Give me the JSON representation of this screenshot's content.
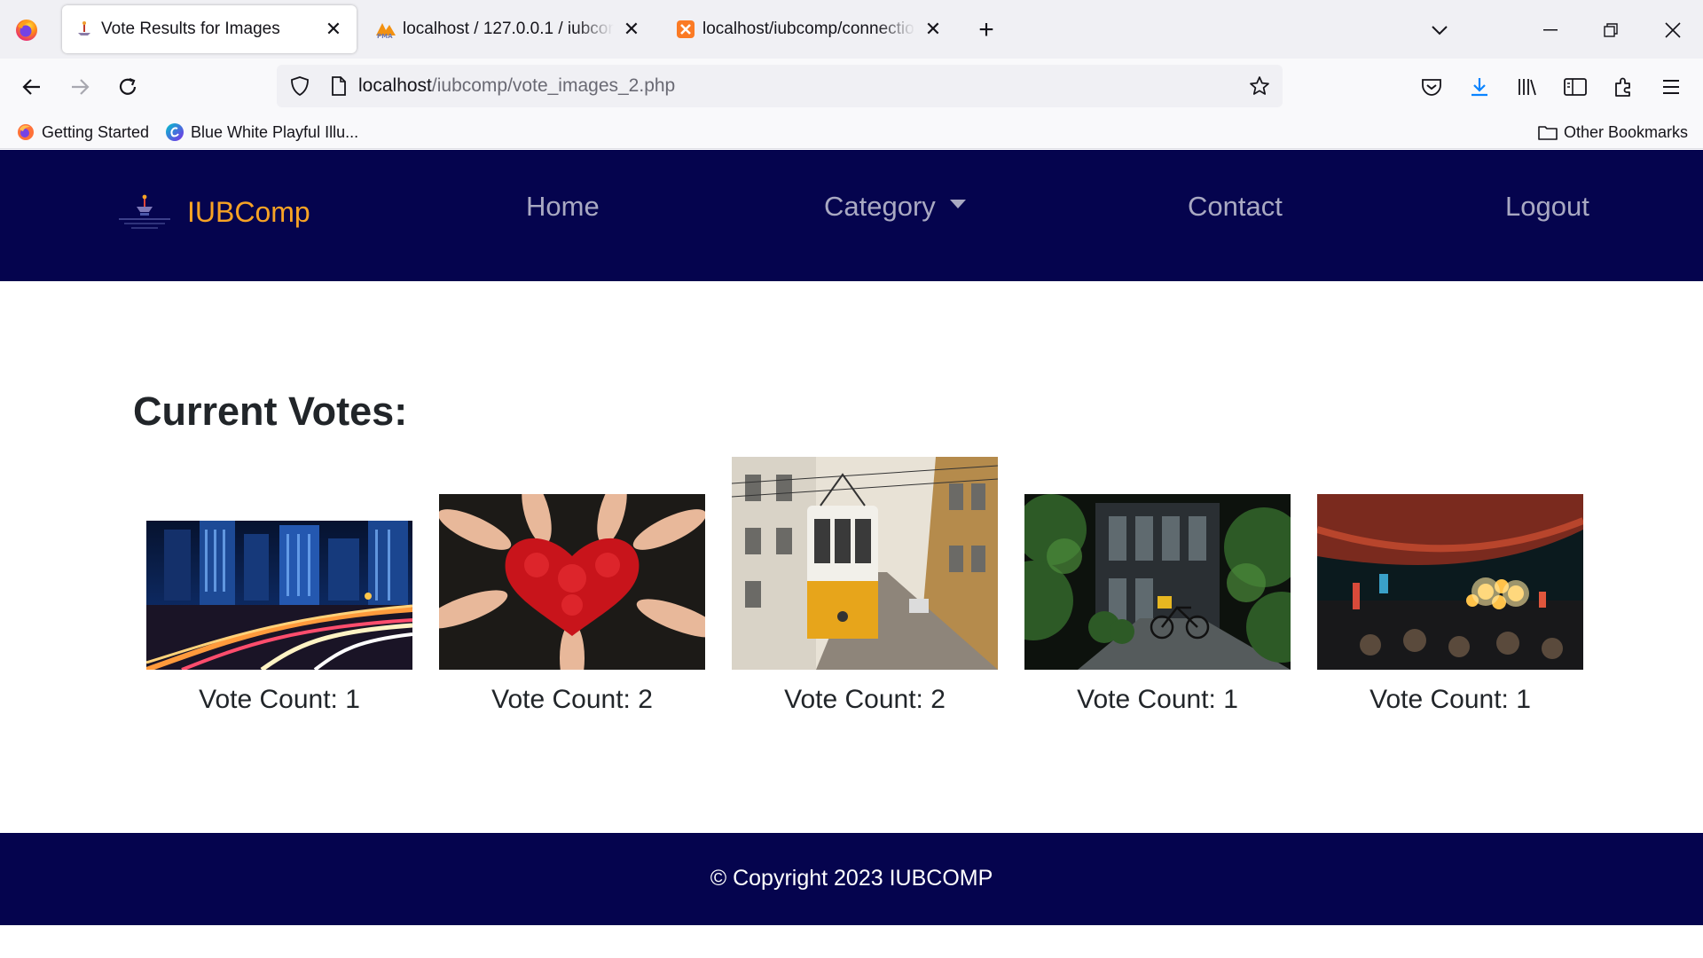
{
  "browser": {
    "tabs": [
      {
        "title": "Vote Results for Images",
        "favicon": "iub-favicon-icon",
        "active": true
      },
      {
        "title": "localhost / 127.0.0.1 / iubcomp",
        "favicon": "phpmyadmin-icon",
        "active": false
      },
      {
        "title": "localhost/iubcomp/connection.php",
        "favicon": "xampp-icon",
        "active": false
      }
    ],
    "url": {
      "host": "localhost",
      "path": "/iubcomp/vote_images_2.php"
    },
    "bookmarks": [
      {
        "label": "Getting Started",
        "icon": "firefox-icon"
      },
      {
        "label": "Blue White Playful Illu...",
        "icon": "canva-icon"
      }
    ],
    "other_bookmarks": "Other Bookmarks"
  },
  "site": {
    "brand": "IUBComp",
    "brand_color": "#f7a325",
    "header_color": "#05044e",
    "nav": {
      "home": "Home",
      "category": "Category",
      "contact": "Contact",
      "logout": "Logout"
    },
    "section_title": "Current Votes:",
    "images": [
      {
        "subject": "city-night-traffic",
        "vote_label": "Vote Count: 1"
      },
      {
        "subject": "red-painted-hands-heart",
        "vote_label": "Vote Count: 2"
      },
      {
        "subject": "yellow-tram-street",
        "vote_label": "Vote Count: 2"
      },
      {
        "subject": "alley-bicycle",
        "vote_label": "Vote Count: 1"
      },
      {
        "subject": "night-street-lights",
        "vote_label": "Vote Count: 1"
      }
    ],
    "footer": "© Copyright 2023 IUBCOMP"
  }
}
